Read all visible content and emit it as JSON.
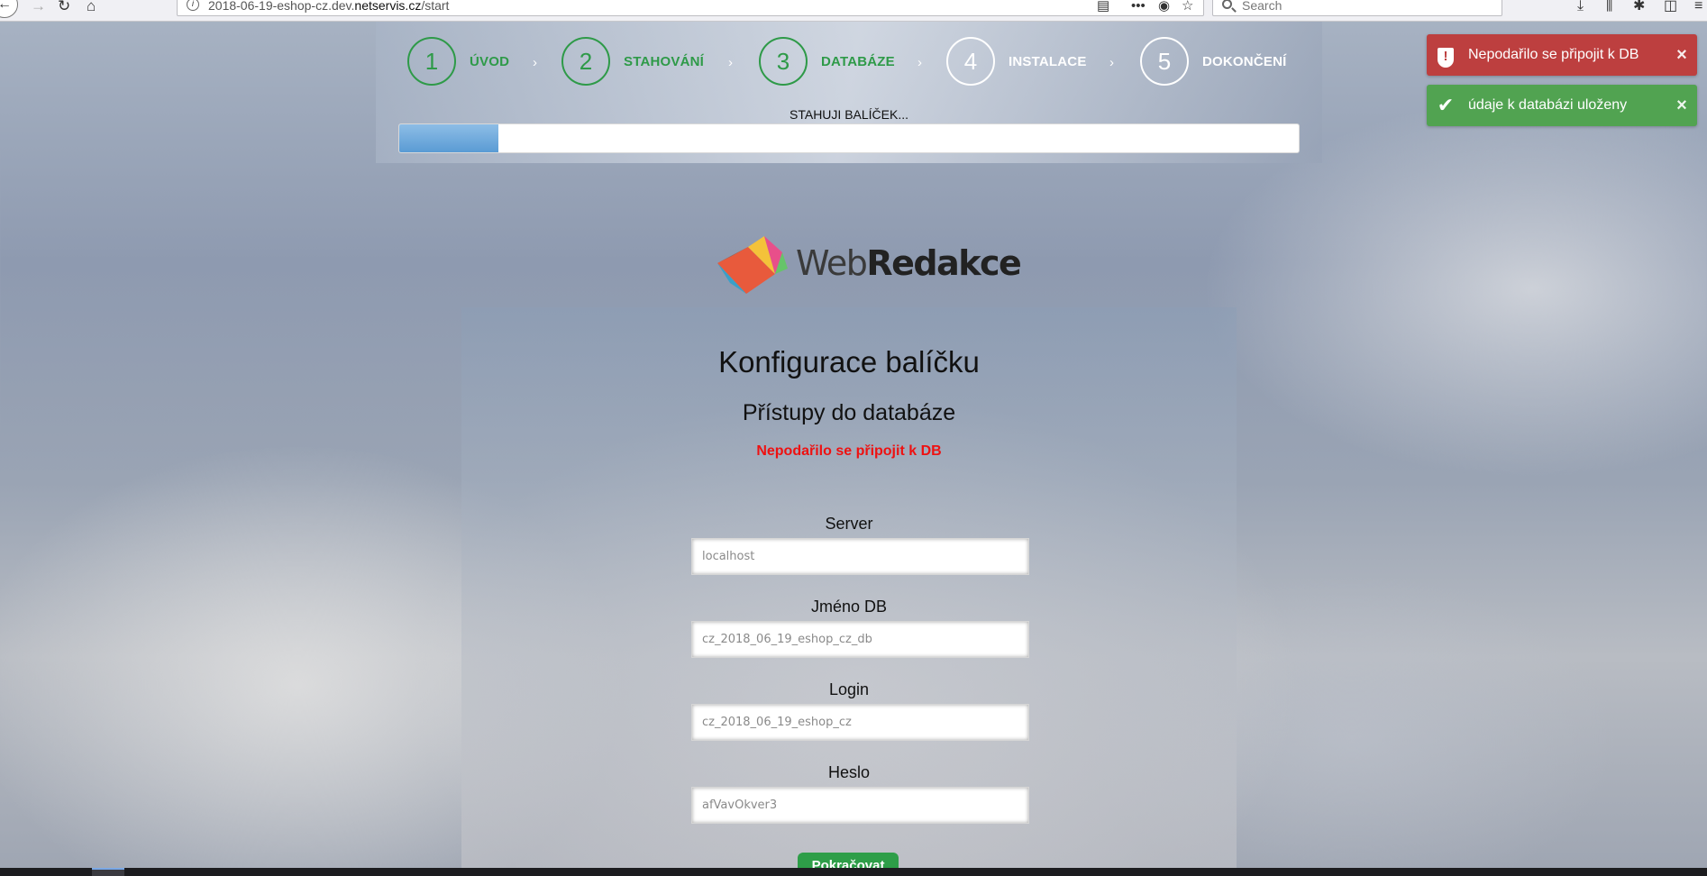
{
  "browser": {
    "url_prefix": "2018-06-19-eshop-cz.dev.",
    "url_domain": "netservis.cz",
    "url_path": "/start",
    "search_placeholder": "Search"
  },
  "steps": [
    {
      "number": "1",
      "label": "ÚVOD",
      "state": "done"
    },
    {
      "number": "2",
      "label": "STAHOVÁNÍ",
      "state": "done"
    },
    {
      "number": "3",
      "label": "DATABÁZE",
      "state": "done"
    },
    {
      "number": "4",
      "label": "INSTALACE",
      "state": "pending"
    },
    {
      "number": "5",
      "label": "DOKONČENÍ",
      "state": "pending"
    }
  ],
  "progress": {
    "label": "STAHUJI BALÍČEK...",
    "fraction": 0.11
  },
  "toasts": {
    "error": {
      "message": "Nepodařilo se připojit k DB",
      "close": "×"
    },
    "success": {
      "message": "údaje k databázi uloženy",
      "close": "×"
    }
  },
  "logo": {
    "text_light": "Web",
    "text_bold": "Redakce"
  },
  "form": {
    "title": "Konfigurace balíčku",
    "subtitle": "Přístupy do databáze",
    "error": "Nepodařilo se připojit k DB",
    "fields": {
      "server": {
        "label": "Server",
        "value": "localhost"
      },
      "dbname": {
        "label": "Jméno DB",
        "value": "cz_2018_06_19_eshop_cz_db"
      },
      "login": {
        "label": "Login",
        "value": "cz_2018_06_19_eshop_cz"
      },
      "password": {
        "label": "Heslo",
        "value": "afVavOkver3"
      }
    },
    "submit_label": "Pokračovat"
  },
  "colors": {
    "accent_green": "#2e9a48",
    "error_red": "#ee1111",
    "toast_error": "#bd3f3f",
    "toast_success": "#51a351",
    "progress_blue": "#5a9bd4"
  }
}
